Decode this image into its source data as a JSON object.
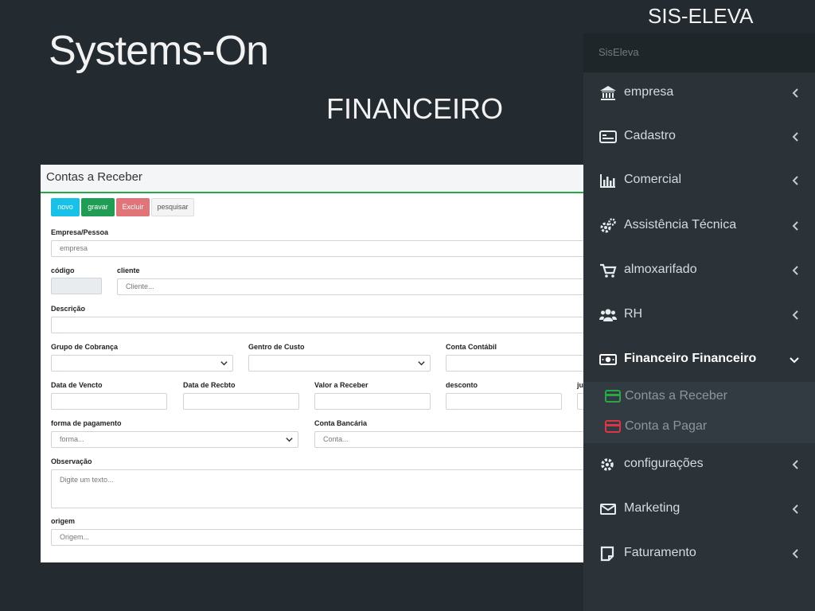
{
  "slide": {
    "title": "Systems-On",
    "subtitle": "FINANCEIRO",
    "top_label": "SIS-ELEVA"
  },
  "form": {
    "title": "Contas a Receber",
    "buttons": {
      "novo": "novo",
      "gravar": "gravar",
      "excluir": "Excluir",
      "pesquisar": "pesquisar"
    },
    "labels": {
      "empresa_pessoa": "Empresa/Pessoa",
      "codigo": "código",
      "cliente": "cliente",
      "descricao": "Descrição",
      "grupo_cobranca": "Grupo de Cobrança",
      "centro_custo": "Gentro de Custo",
      "conta_contabil": "Conta Contábil",
      "data_vencto": "Data de Vencto",
      "data_recbto": "Data de Recbto",
      "valor_receber": "Valor a Receber",
      "desconto": "desconto",
      "juros": "ju",
      "forma_pagamento": "forma de pagamento",
      "conta_bancaria": "Conta Bancária",
      "observacao": "Observação",
      "origem": "origem"
    },
    "placeholders": {
      "empresa": "empresa",
      "cliente": "Cliente...",
      "forma": "forma...",
      "conta": "Conta...",
      "observacao": "Digite um texto...",
      "origem": "Origem..."
    }
  },
  "sidebar": {
    "brand": "SisEleva",
    "items": [
      {
        "label": "empresa",
        "icon": "bank-icon"
      },
      {
        "label": "Cadastro",
        "icon": "id-card-icon"
      },
      {
        "label": "Comercial",
        "icon": "bar-chart-icon"
      },
      {
        "label": "Assistência Técnica",
        "icon": "gears-icon"
      },
      {
        "label": "almoxarifado",
        "icon": "cart-icon"
      },
      {
        "label": "RH",
        "icon": "users-icon"
      },
      {
        "label": "Financeiro Financeiro",
        "icon": "money-icon"
      },
      {
        "label": "configurações",
        "icon": "gear-icon"
      },
      {
        "label": "Marketing",
        "icon": "envelope-icon"
      },
      {
        "label": "Faturamento",
        "icon": "note-icon"
      }
    ],
    "submenu": [
      {
        "label": "Contas a Receber",
        "icon": "credit-card-icon",
        "color": "#28a745"
      },
      {
        "label": "Conta a Pagar",
        "icon": "credit-card-icon",
        "color": "#dc3545"
      }
    ]
  }
}
